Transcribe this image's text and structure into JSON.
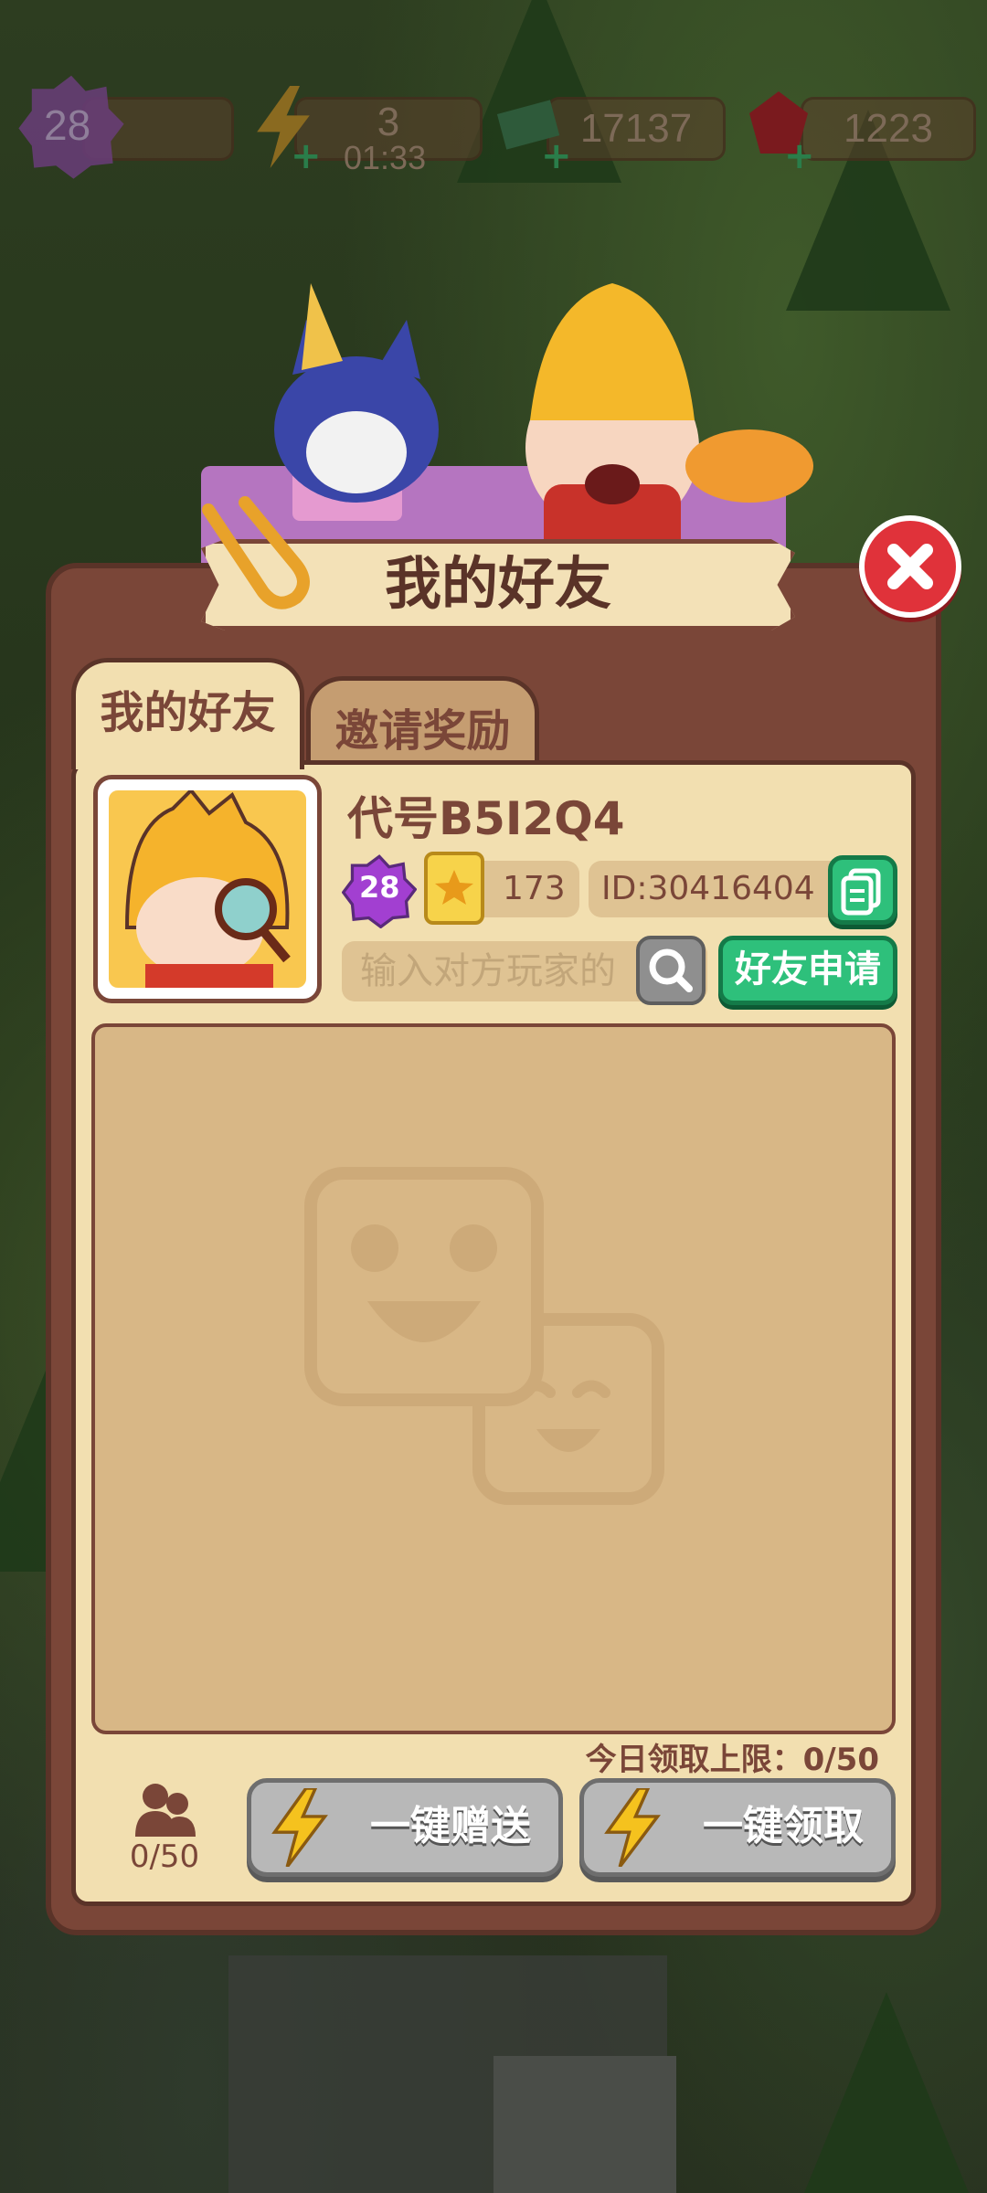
{
  "hud": {
    "level": "28",
    "energy": "3",
    "energy_timer": "01:33",
    "cash": "17137",
    "gems": "1223"
  },
  "dialog": {
    "title": "我的好友",
    "tabs": [
      {
        "label": "我的好友",
        "active": true
      },
      {
        "label": "邀请奖励",
        "active": false
      }
    ],
    "player": {
      "name": "代号B5I2Q4",
      "level": "28",
      "stars": "173",
      "id_text": "ID:30416404"
    },
    "search": {
      "placeholder": "输入对方玩家的"
    },
    "friend_request_label": "好友申请",
    "daily_limit_text": "今日领取上限：0/50",
    "friend_count": "0/50",
    "gift_all_label": "一键赠送",
    "claim_all_label": "一键领取"
  },
  "colors": {
    "panel": "#7a4638",
    "panel_inner": "#f2dfb0",
    "accent_green": "#2ec07b",
    "close_red": "#e0323a"
  }
}
